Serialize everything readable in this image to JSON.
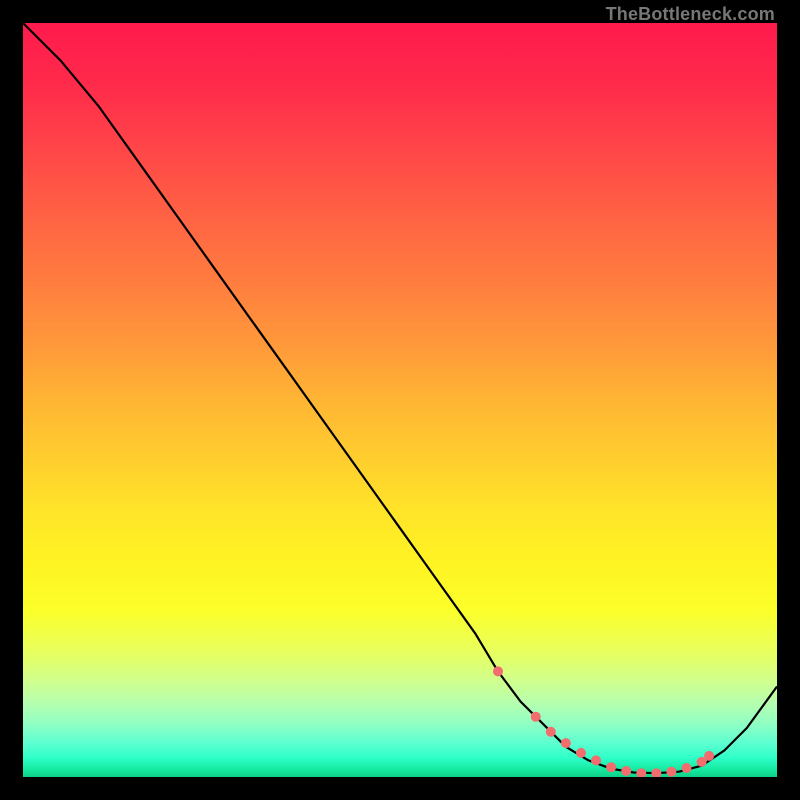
{
  "watermark": "TheBottleneck.com",
  "chart_data": {
    "type": "line",
    "title": "",
    "xlabel": "",
    "ylabel": "",
    "xlim": [
      0,
      100
    ],
    "ylim": [
      0,
      100
    ],
    "series": [
      {
        "name": "curve",
        "x": [
          0,
          5,
          10,
          15,
          20,
          25,
          30,
          35,
          40,
          45,
          50,
          55,
          60,
          63,
          66,
          69,
          72,
          75,
          78,
          81,
          84,
          87,
          90,
          93,
          96,
          100
        ],
        "y": [
          100,
          95,
          89,
          82,
          75,
          68,
          61,
          54,
          47,
          40,
          33,
          26,
          19,
          14,
          10,
          7,
          4,
          2.2,
          1.1,
          0.6,
          0.5,
          0.7,
          1.5,
          3.5,
          6.5,
          12
        ]
      }
    ],
    "markers": {
      "name": "highlight-dots",
      "color": "#f26d6d",
      "x": [
        63,
        68,
        70,
        72,
        74,
        76,
        78,
        80,
        82,
        84,
        86,
        88,
        90,
        91
      ],
      "y": [
        14,
        8,
        6,
        4.5,
        3.2,
        2.2,
        1.3,
        0.8,
        0.5,
        0.5,
        0.7,
        1.2,
        2.0,
        2.8
      ]
    }
  }
}
